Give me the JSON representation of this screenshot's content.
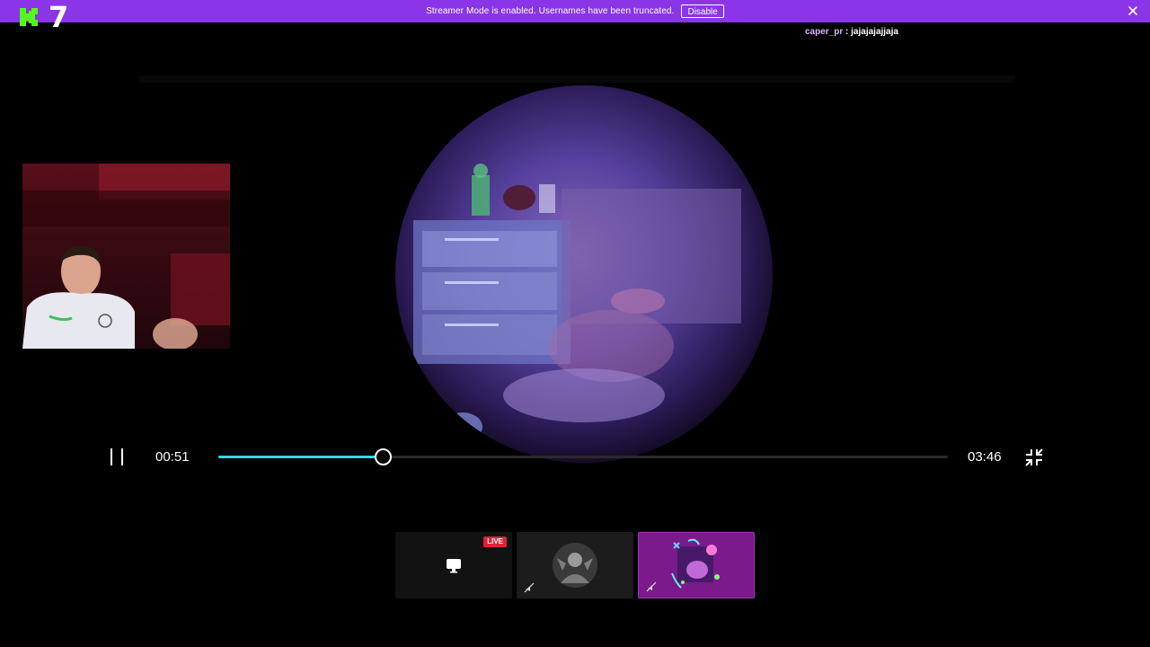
{
  "banner": {
    "message": "Streamer Mode is enabled. Usernames have been truncated.",
    "disable_label": "Disable",
    "color": "#8a35e8"
  },
  "logo": {
    "letter_icon": "kick-k-icon",
    "number": "7",
    "color": "#53fc18"
  },
  "chat": {
    "username": "caper_pr",
    "separator": " : ",
    "message": "jajajajajjaja"
  },
  "player": {
    "current_time": "00:51",
    "total_time": "03:46",
    "progress_percent": 22.5,
    "accent": "#3fd3e6"
  },
  "thumbnails": [
    {
      "badge": "LIVE",
      "icon": "screen-icon"
    },
    {
      "icon": "muted-icon"
    },
    {
      "icon": "muted-icon"
    }
  ]
}
